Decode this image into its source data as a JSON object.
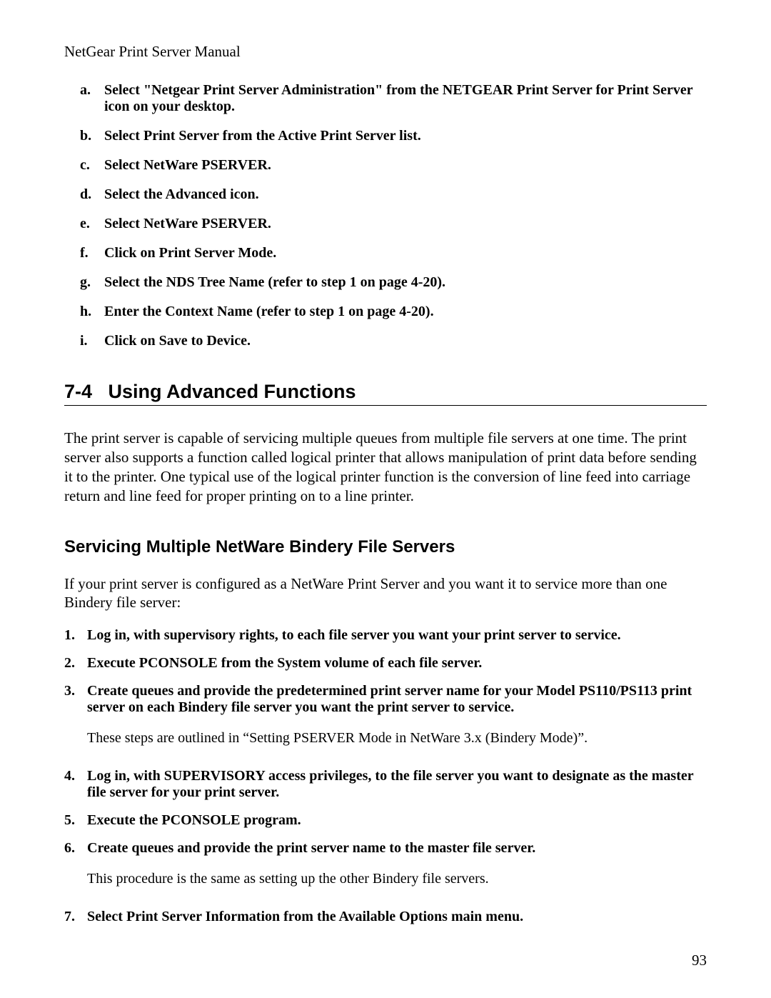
{
  "header": "NetGear Print Server Manual",
  "alpha_list": [
    {
      "marker": "a.",
      "text": "Select \"Netgear Print Server Administration\" from the NETGEAR Print Server for Print Server icon on your desktop."
    },
    {
      "marker": "b.",
      "text": "Select Print Server from the Active Print Server list."
    },
    {
      "marker": "c.",
      "text": "Select NetWare PSERVER."
    },
    {
      "marker": "d.",
      "text": "Select the Advanced icon."
    },
    {
      "marker": "e.",
      "text": "Select NetWare PSERVER."
    },
    {
      "marker": "f.",
      "text": "Click on Print Server Mode."
    },
    {
      "marker": "g.",
      "text": "Select the NDS Tree Name (refer to step 1 on page 4-20)."
    },
    {
      "marker": "h.",
      "text": "Enter the Context Name (refer to step 1 on page 4-20)."
    },
    {
      "marker": "i.",
      "text": "Click on Save to Device."
    }
  ],
  "section": {
    "number": "7-4",
    "title": "Using Advanced Functions"
  },
  "section_para": "The print server is capable of servicing multiple queues from multiple file servers at one time. The print server also supports a function called logical printer that allows manipulation of print data before sending it to the printer. One typical use of the logical printer function is the conversion of line feed into carriage return and line feed for proper printing on to a line printer.",
  "subheading": "Servicing Multiple NetWare Bindery File Servers",
  "sub_para": "If your print server is configured as a NetWare Print Server and you want it to service more than one Bindery file server:",
  "num_list": [
    {
      "marker": "1.",
      "text": "Log in, with supervisory rights, to each file server you want your print server to service."
    },
    {
      "marker": "2.",
      "text": "Execute PCONSOLE from the System volume of each file server."
    },
    {
      "marker": "3.",
      "text": "Create queues and provide the predetermined print server name for your Model PS110/PS113 print server on each Bindery file server you want the print server to service.",
      "note": "These steps are outlined in “Setting PSERVER Mode in NetWare 3.x (Bindery Mode)”."
    },
    {
      "marker": "4.",
      "text": "Log in, with SUPERVISORY access privileges, to the file server you want to designate as the master file server for your print server."
    },
    {
      "marker": "5.",
      "text": "Execute the PCONSOLE program."
    },
    {
      "marker": "6.",
      "text": "Create queues and provide the print server name to the master file server.",
      "note": "This procedure is the same as setting up the other Bindery file servers."
    },
    {
      "marker": "7.",
      "text": "Select Print Server Information from the Available Options main menu."
    }
  ],
  "page_number": "93"
}
